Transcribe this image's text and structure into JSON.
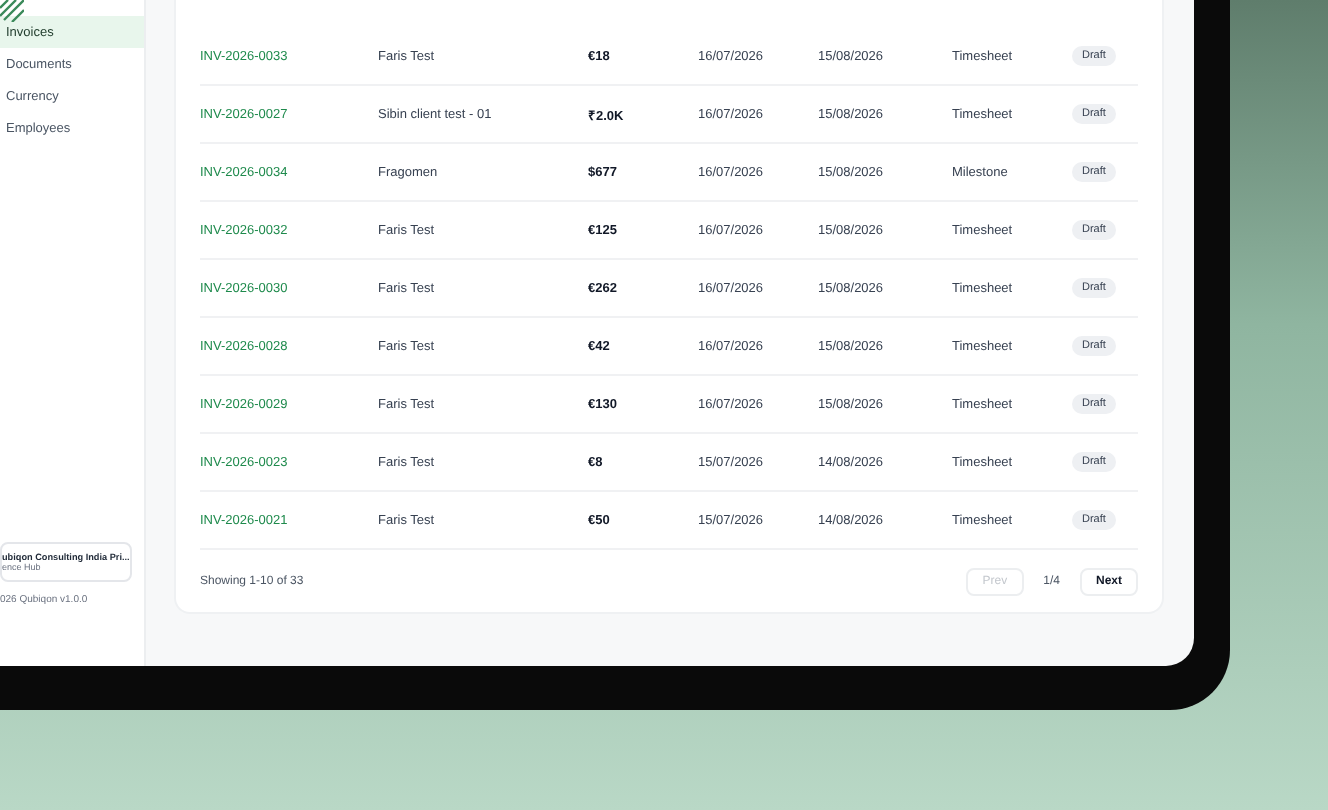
{
  "sidebar": {
    "items": [
      {
        "label": "Invoices",
        "selected": true
      },
      {
        "label": "Documents",
        "selected": false
      },
      {
        "label": "Currency",
        "selected": false
      },
      {
        "label": "Employees",
        "selected": false
      }
    ],
    "org_switcher": {
      "name": "ubiqon Consulting India Pri...",
      "subtitle": "ence Hub"
    },
    "version": "026 Qubiqon v1.0.0"
  },
  "table": {
    "rows": [
      {
        "invoice": "INV-2026-0033",
        "client": "Faris Test",
        "amount": "€18",
        "issue_date": "16/07/2026",
        "due_date": "15/08/2026",
        "type": "Timesheet",
        "status": "Draft"
      },
      {
        "invoice": "INV-2026-0027",
        "client": "Sibin client test - 01",
        "amount": "₹2.0K",
        "issue_date": "16/07/2026",
        "due_date": "15/08/2026",
        "type": "Timesheet",
        "status": "Draft"
      },
      {
        "invoice": "INV-2026-0034",
        "client": "Fragomen",
        "amount": "$677",
        "issue_date": "16/07/2026",
        "due_date": "15/08/2026",
        "type": "Milestone",
        "status": "Draft"
      },
      {
        "invoice": "INV-2026-0032",
        "client": "Faris Test",
        "amount": "€125",
        "issue_date": "16/07/2026",
        "due_date": "15/08/2026",
        "type": "Timesheet",
        "status": "Draft"
      },
      {
        "invoice": "INV-2026-0030",
        "client": "Faris Test",
        "amount": "€262",
        "issue_date": "16/07/2026",
        "due_date": "15/08/2026",
        "type": "Timesheet",
        "status": "Draft"
      },
      {
        "invoice": "INV-2026-0028",
        "client": "Faris Test",
        "amount": "€42",
        "issue_date": "16/07/2026",
        "due_date": "15/08/2026",
        "type": "Timesheet",
        "status": "Draft"
      },
      {
        "invoice": "INV-2026-0029",
        "client": "Faris Test",
        "amount": "€130",
        "issue_date": "16/07/2026",
        "due_date": "15/08/2026",
        "type": "Timesheet",
        "status": "Draft"
      },
      {
        "invoice": "INV-2026-0023",
        "client": "Faris Test",
        "amount": "€8",
        "issue_date": "15/07/2026",
        "due_date": "14/08/2026",
        "type": "Timesheet",
        "status": "Draft"
      },
      {
        "invoice": "INV-2026-0021",
        "client": "Faris Test",
        "amount": "€50",
        "issue_date": "15/07/2026",
        "due_date": "14/08/2026",
        "type": "Timesheet",
        "status": "Draft"
      }
    ]
  },
  "pagination": {
    "summary": "Showing 1-10 of 33",
    "prev": {
      "label": "Prev",
      "disabled": true
    },
    "page": "1/4",
    "next": {
      "label": "Next",
      "disabled": false
    }
  }
}
